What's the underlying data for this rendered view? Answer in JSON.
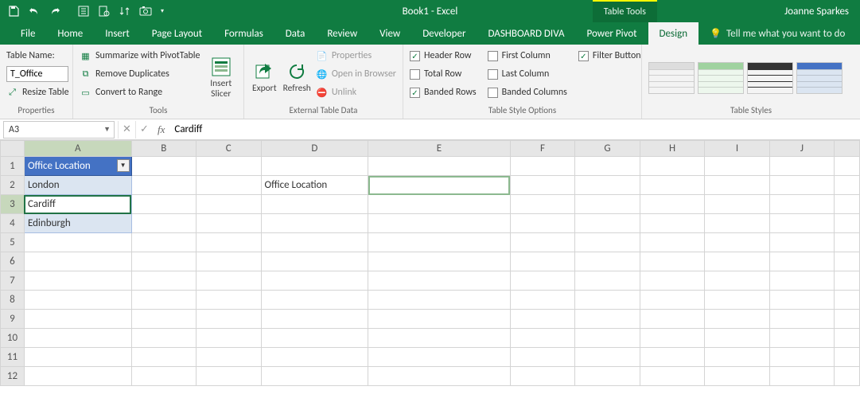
{
  "title": {
    "doc": "Book1",
    "app": "Excel",
    "combo": "Book1  -  Excel"
  },
  "context_tab": "Table Tools",
  "user": "Joanne Sparkes",
  "tabs": [
    "File",
    "Home",
    "Insert",
    "Page Layout",
    "Formulas",
    "Data",
    "Review",
    "View",
    "Developer",
    "DASHBOARD DIVA",
    "Power Pivot",
    "Design"
  ],
  "active_tab": "Design",
  "tell_me": "Tell me what you want to do",
  "ribbon": {
    "properties": {
      "table_name_label": "Table Name:",
      "table_name_value": "T_Office",
      "resize": "Resize Table",
      "group": "Properties"
    },
    "tools": {
      "pivot": "Summarize with PivotTable",
      "dups": "Remove Duplicates",
      "range": "Convert to Range",
      "slicer": "Insert Slicer",
      "group": "Tools"
    },
    "ext": {
      "export": "Export",
      "refresh": "Refresh",
      "props": "Properties",
      "open": "Open in Browser",
      "unlink": "Unlink",
      "group": "External Table Data"
    },
    "opts": {
      "hdr": "Header Row",
      "first": "First Column",
      "filter": "Filter Button",
      "total": "Total Row",
      "last": "Last Column",
      "brow": "Banded Rows",
      "bcol": "Banded Columns",
      "group": "Table Style Options"
    },
    "styles_group": "Table Styles"
  },
  "formula_bar": {
    "name_box": "A3",
    "formula": "Cardiff"
  },
  "columns": [
    "A",
    "B",
    "C",
    "D",
    "E",
    "F",
    "G",
    "H",
    "I",
    "J"
  ],
  "rows_shown": 12,
  "cells": {
    "A1": "Office Location",
    "A2": "London",
    "A3": "Cardiff",
    "A4": "Edinburgh",
    "D2": "Office Location"
  },
  "table_range": {
    "col": "A",
    "rows": [
      1,
      4
    ]
  },
  "active_cell": "A3",
  "selected_range_E2": true,
  "chart_data": null,
  "qat_icons": [
    "save-icon",
    "undo-icon",
    "redo-icon",
    "new-sheet-icon",
    "print-preview-icon",
    "sort-icon",
    "camera-icon"
  ]
}
